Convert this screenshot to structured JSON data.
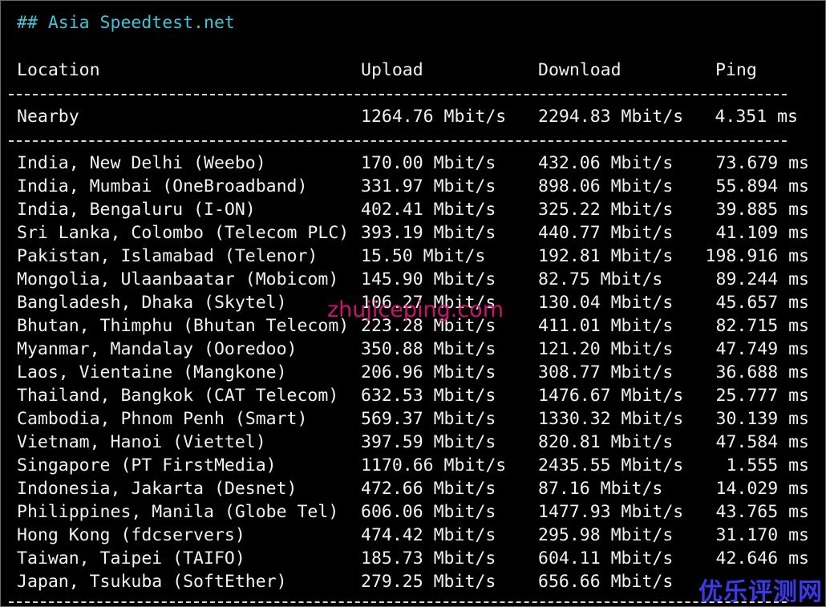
{
  "title": "## Asia Speedtest.net",
  "columns": {
    "location": "Location",
    "upload": "Upload",
    "download": "Download",
    "ping": "Ping"
  },
  "nearby": {
    "location": "Nearby",
    "upload": "1264.76 Mbit/s",
    "download": "2294.83 Mbit/s",
    "ping": "4.351 ms"
  },
  "rows": [
    {
      "location": "India, New Delhi (Weebo)",
      "upload": "170.00 Mbit/s",
      "download": "432.06 Mbit/s",
      "ping": "73.679 ms"
    },
    {
      "location": "India, Mumbai (OneBroadband)",
      "upload": "331.97 Mbit/s",
      "download": "898.06 Mbit/s",
      "ping": "55.894 ms"
    },
    {
      "location": "India, Bengaluru (I-ON)",
      "upload": "402.41 Mbit/s",
      "download": "325.22 Mbit/s",
      "ping": "39.885 ms"
    },
    {
      "location": "Sri Lanka, Colombo (Telecom PLC)",
      "upload": "393.19 Mbit/s",
      "download": "440.77 Mbit/s",
      "ping": "41.109 ms"
    },
    {
      "location": "Pakistan, Islamabad (Telenor)",
      "upload": "15.50 Mbit/s",
      "download": "192.81 Mbit/s",
      "ping": "198.916 ms"
    },
    {
      "location": "Mongolia, Ulaanbaatar (Mobicom)",
      "upload": "145.90 Mbit/s",
      "download": "82.75 Mbit/s",
      "ping": "89.244 ms"
    },
    {
      "location": "Bangladesh, Dhaka (Skytel)",
      "upload": "106.27 Mbit/s",
      "download": "130.04 Mbit/s",
      "ping": "45.657 ms"
    },
    {
      "location": "Bhutan, Thimphu (Bhutan Telecom)",
      "upload": "223.28 Mbit/s",
      "download": "411.01 Mbit/s",
      "ping": "82.715 ms"
    },
    {
      "location": "Myanmar, Mandalay (Ooredoo)",
      "upload": "350.88 Mbit/s",
      "download": "121.20 Mbit/s",
      "ping": "47.749 ms"
    },
    {
      "location": "Laos, Vientaine (Mangkone)",
      "upload": "206.96 Mbit/s",
      "download": "308.77 Mbit/s",
      "ping": "36.688 ms"
    },
    {
      "location": "Thailand, Bangkok (CAT Telecom)",
      "upload": "632.53 Mbit/s",
      "download": "1476.67 Mbit/s",
      "ping": "25.777 ms"
    },
    {
      "location": "Cambodia, Phnom Penh (Smart)",
      "upload": "569.37 Mbit/s",
      "download": "1330.32 Mbit/s",
      "ping": "30.139 ms"
    },
    {
      "location": "Vietnam, Hanoi (Viettel)",
      "upload": "397.59 Mbit/s",
      "download": "820.81 Mbit/s",
      "ping": "47.584 ms"
    },
    {
      "location": "Singapore (PT FirstMedia)",
      "upload": "1170.66 Mbit/s",
      "download": "2435.55 Mbit/s",
      "ping": "1.555 ms"
    },
    {
      "location": "Indonesia, Jakarta (Desnet)",
      "upload": "472.66 Mbit/s",
      "download": "87.16 Mbit/s",
      "ping": "14.029 ms"
    },
    {
      "location": "Philippines, Manila (Globe Tel)",
      "upload": "606.06 Mbit/s",
      "download": "1477.93 Mbit/s",
      "ping": "43.765 ms"
    },
    {
      "location": "Hong Kong (fdcservers)",
      "upload": "474.42 Mbit/s",
      "download": "295.98 Mbit/s",
      "ping": "31.170 ms"
    },
    {
      "location": "Taiwan, Taipei (TAIFO)",
      "upload": "185.73 Mbit/s",
      "download": "604.11 Mbit/s",
      "ping": "42.646 ms"
    },
    {
      "location": "Japan, Tsukuba (SoftEther)",
      "upload": "279.25 Mbit/s",
      "download": "656.66 Mbit/s",
      "ping": ""
    }
  ],
  "watermark": "zhujiceping.com",
  "corner_logo": "优乐评测网",
  "colors": {
    "background": "#000000",
    "text": "#f2f2f2",
    "title": "#3ec6d8",
    "watermark": "#e0157a",
    "corner_logo": "#3a3ae8"
  }
}
